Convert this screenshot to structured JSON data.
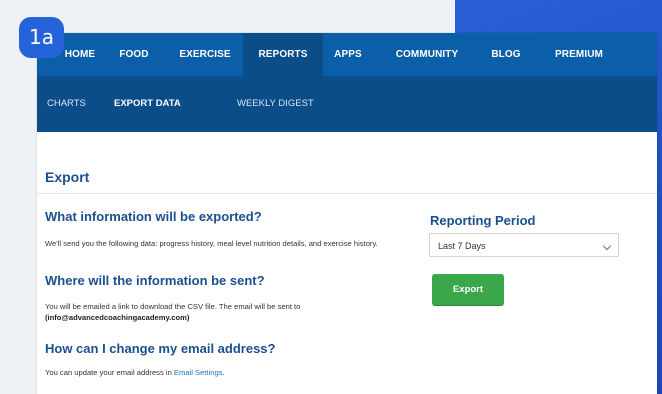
{
  "badge": "1a",
  "nav": {
    "items": [
      {
        "label": "HOME"
      },
      {
        "label": "FOOD"
      },
      {
        "label": "EXERCISE"
      },
      {
        "label": "REPORTS"
      },
      {
        "label": "APPS"
      },
      {
        "label": "COMMUNITY"
      },
      {
        "label": "BLOG"
      },
      {
        "label": "PREMIUM"
      }
    ],
    "active": "REPORTS"
  },
  "subnav": {
    "items": [
      {
        "label": "CHARTS"
      },
      {
        "label": "EXPORT DATA"
      },
      {
        "label": "WEEKLY DIGEST"
      }
    ],
    "active": "EXPORT DATA"
  },
  "main": {
    "title": "Export",
    "sections": [
      {
        "heading": "What information will be exported?",
        "text": "We'll send you the following data: progress history, meal level nutrition details, and exercise history."
      },
      {
        "heading": "Where will the information be sent?",
        "text": "You will be emailed a link to download the CSV file. The email will be sent to",
        "email": "(info@advancedcoachingacademy.com)"
      },
      {
        "heading": "How can I change my email address?",
        "text": "You can update your email address in",
        "link": "Email Settings",
        "suffix": "."
      }
    ]
  },
  "reporting": {
    "title": "Reporting Period",
    "selected": "Last 7 Days",
    "button": "Export"
  },
  "colors": {
    "nav": "#0b5fa8",
    "subnav": "#0a4d89",
    "heading": "#1c4f8f",
    "button": "#3aa84a",
    "accent": "#2563d9"
  }
}
